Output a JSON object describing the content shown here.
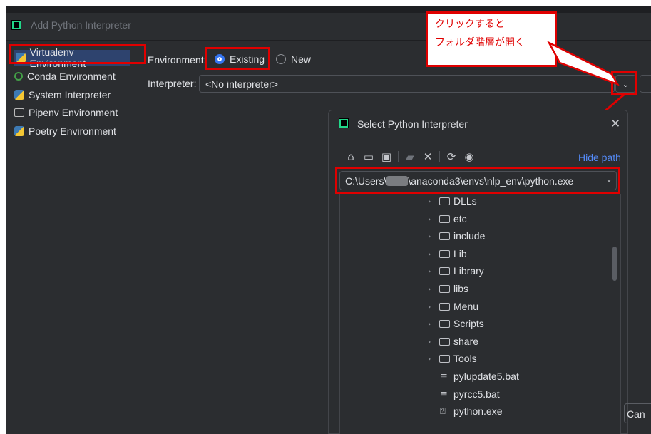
{
  "window": {
    "title": "Add Python Interpreter"
  },
  "sidebar": {
    "items": [
      {
        "label": "Virtualenv Environment",
        "icon": "python-virtualenv-icon",
        "selected": true
      },
      {
        "label": "Conda Environment",
        "icon": "conda-icon",
        "selected": false
      },
      {
        "label": "System Interpreter",
        "icon": "python-icon",
        "selected": false
      },
      {
        "label": "Pipenv Environment",
        "icon": "pipenv-icon",
        "selected": false
      },
      {
        "label": "Poetry Environment",
        "icon": "poetry-icon",
        "selected": false
      }
    ]
  },
  "form": {
    "environment_label": "Environment:",
    "existing_label": "Existing",
    "new_label": "New",
    "interpreter_label": "Interpreter:",
    "interpreter_value": "<No interpreter>"
  },
  "callout": {
    "line1": "クリックすると",
    "line2": "フォルダ階層が開く",
    "color": "#e00000"
  },
  "dialog": {
    "title": "Select Python Interpreter",
    "hide_path_label": "Hide path",
    "path_prefix": "C:\\Users\\",
    "path_suffix": "\\anaconda3\\envs\\nlp_env\\python.exe",
    "tree": [
      {
        "label": "DLLs",
        "type": "folder"
      },
      {
        "label": "etc",
        "type": "folder"
      },
      {
        "label": "include",
        "type": "folder"
      },
      {
        "label": "Lib",
        "type": "folder"
      },
      {
        "label": "Library",
        "type": "folder"
      },
      {
        "label": "libs",
        "type": "folder"
      },
      {
        "label": "Menu",
        "type": "folder"
      },
      {
        "label": "Scripts",
        "type": "folder"
      },
      {
        "label": "share",
        "type": "folder"
      },
      {
        "label": "Tools",
        "type": "folder"
      },
      {
        "label": "pylupdate5.bat",
        "type": "file"
      },
      {
        "label": "pyrcc5.bat",
        "type": "file"
      },
      {
        "label": "python.exe",
        "type": "exe"
      }
    ]
  },
  "footer": {
    "cancel_partial": "Can"
  },
  "colors": {
    "accent": "#3574f0",
    "annotation": "#e00000",
    "background": "#2b2d30",
    "link": "#548af7"
  }
}
